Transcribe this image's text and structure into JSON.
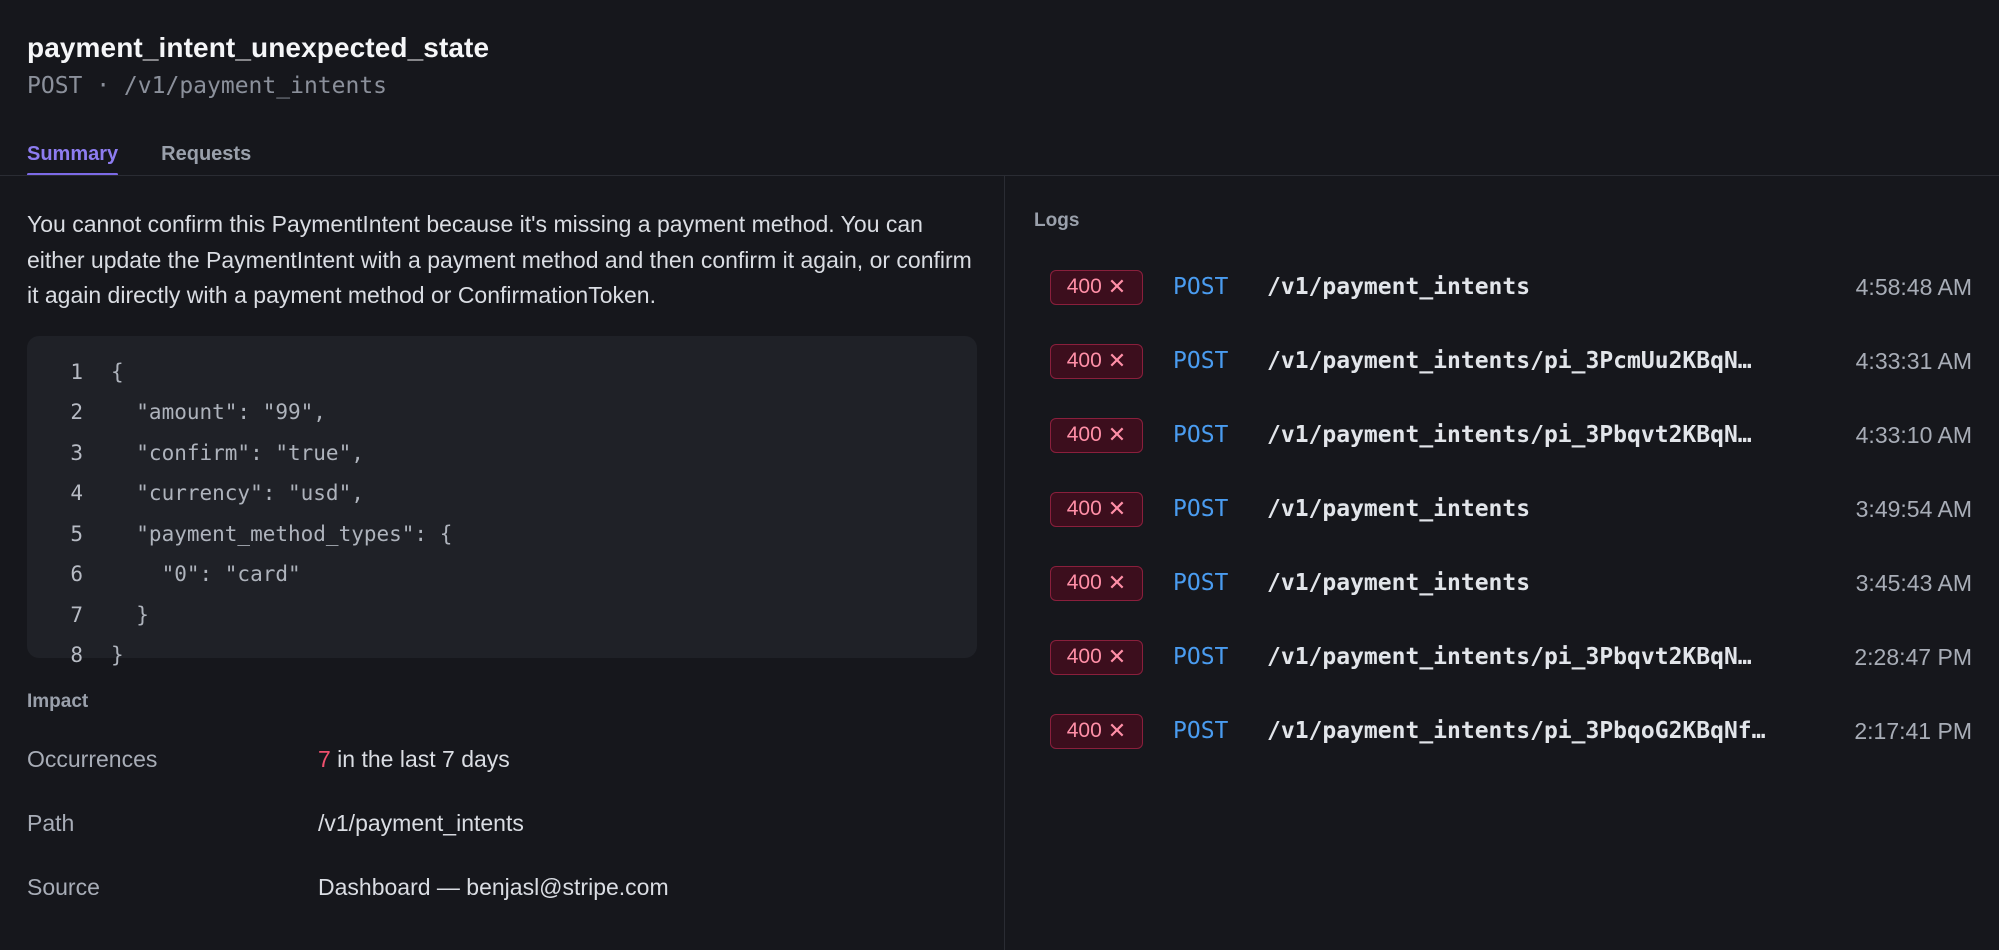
{
  "header": {
    "title": "payment_intent_unexpected_state",
    "subtitle": "POST · /v1/payment_intents"
  },
  "tabs": [
    {
      "label": "Summary",
      "active": true
    },
    {
      "label": "Requests",
      "active": false
    }
  ],
  "summary": {
    "description": "You cannot confirm this PaymentIntent because it's missing a payment method. You can either update the PaymentIntent with a payment method and then confirm it again, or confirm it again directly with a payment method or ConfirmationToken.",
    "code_lines": [
      {
        "n": "1",
        "text": "{"
      },
      {
        "n": "2",
        "text": "  \"amount\": \"99\","
      },
      {
        "n": "3",
        "text": "  \"confirm\": \"true\","
      },
      {
        "n": "4",
        "text": "  \"currency\": \"usd\","
      },
      {
        "n": "5",
        "text": "  \"payment_method_types\": {"
      },
      {
        "n": "6",
        "text": "    \"0\": \"card\""
      },
      {
        "n": "7",
        "text": "  }"
      },
      {
        "n": "8",
        "text": "}"
      }
    ]
  },
  "impact": {
    "heading": "Impact",
    "occurrences_label": "Occurrences",
    "occurrences_count": "7",
    "occurrences_suffix": " in the last 7 days",
    "path_label": "Path",
    "path_value": "/v1/payment_intents",
    "source_label": "Source",
    "source_value": "Dashboard — benjasl@stripe.com"
  },
  "logs": {
    "heading": "Logs",
    "badge_icon": "close-x-icon",
    "items": [
      {
        "status": "400",
        "method": "POST",
        "path": "/v1/payment_intents",
        "time": "4:58:48 AM"
      },
      {
        "status": "400",
        "method": "POST",
        "path": "/v1/payment_intents/pi_3PcmUu2KBqN…",
        "time": "4:33:31 AM"
      },
      {
        "status": "400",
        "method": "POST",
        "path": "/v1/payment_intents/pi_3Pbqvt2KBqN…",
        "time": "4:33:10 AM"
      },
      {
        "status": "400",
        "method": "POST",
        "path": "/v1/payment_intents",
        "time": "3:49:54 AM"
      },
      {
        "status": "400",
        "method": "POST",
        "path": "/v1/payment_intents",
        "time": "3:45:43 AM"
      },
      {
        "status": "400",
        "method": "POST",
        "path": "/v1/payment_intents/pi_3Pbqvt2KBqN…",
        "time": "2:28:47 PM"
      },
      {
        "status": "400",
        "method": "POST",
        "path": "/v1/payment_intents/pi_3PbqoG2KBqNf…",
        "time": "2:17:41 PM"
      }
    ]
  },
  "colors": {
    "background": "#16171c",
    "accent": "#7c6ae6",
    "error": "#f0506e",
    "method": "#4a9cf0"
  }
}
